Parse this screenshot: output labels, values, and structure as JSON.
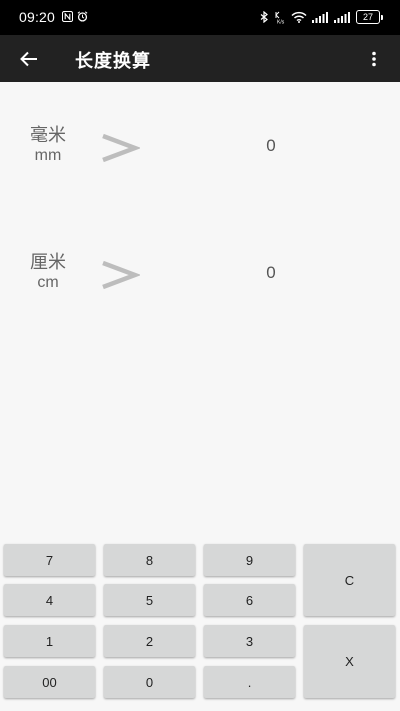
{
  "status_bar": {
    "time": "09:20",
    "battery": "27",
    "left_icons": [
      "nfc-icon",
      "alarm-icon"
    ],
    "right_icons": [
      "bluetooth-icon",
      "data-speed-icon",
      "wifi-icon",
      "signal-icon",
      "signal-icon"
    ]
  },
  "app_bar": {
    "title": "长度换算",
    "back_icon": "arrow-left-icon",
    "menu_icon": "more-vertical-icon"
  },
  "conversions": [
    {
      "unit_name": "毫米",
      "unit_abbr": "mm",
      "value": "0"
    },
    {
      "unit_name": "厘米",
      "unit_abbr": "cm",
      "value": "0"
    }
  ],
  "keypad": {
    "k7": "7",
    "k8": "8",
    "k9": "9",
    "clear": "C",
    "k4": "4",
    "k5": "5",
    "k6": "6",
    "k1": "1",
    "k2": "2",
    "k3": "3",
    "delete": "X",
    "k00": "00",
    "k0": "0",
    "dot": "."
  },
  "colors": {
    "status_bar_bg": "#000000",
    "app_bar_bg": "#222222",
    "page_bg": "#f7f7f7",
    "key_bg": "#d6d7d7",
    "arrow": "#bdbdbd"
  }
}
